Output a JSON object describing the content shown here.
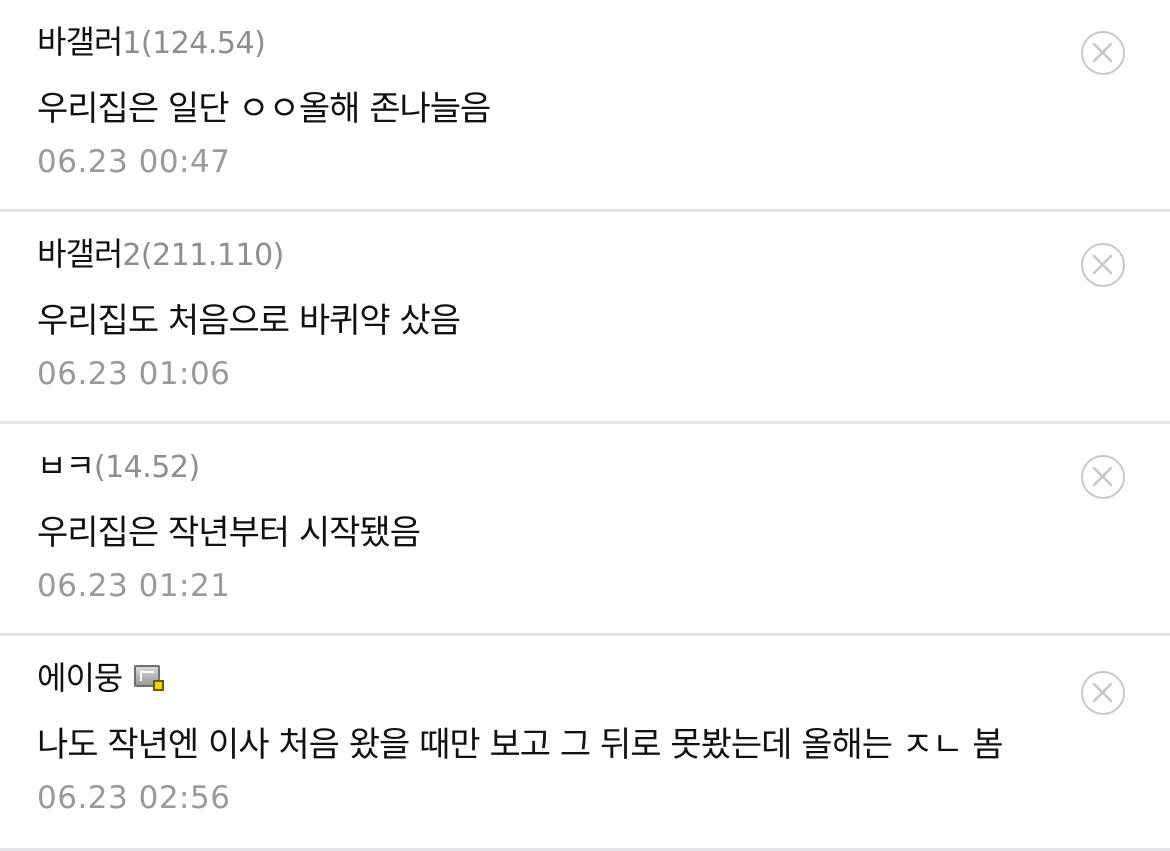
{
  "comments": [
    {
      "nick": "바갤러",
      "ip": "1(124.54)",
      "memo": "우리집은 일단 ㅇㅇ올해 존나늘음",
      "date": "06.23 00:47",
      "delete_icon": "circle-x-icon"
    },
    {
      "nick": "바갤러",
      "ip": "2(211.110)",
      "memo": "우리집도 처음으로 바퀴약 샀음",
      "date": "06.23 01:06",
      "delete_icon": "circle-x-icon"
    },
    {
      "nick": "ㅂㅋ",
      "ip": "(14.52)",
      "memo": "우리집은 작년부터 시작됐음",
      "date": "06.23 01:21",
      "delete_icon": "circle-x-icon"
    },
    {
      "nick": "에이뭉",
      "badge_icon": "fixed-nick-icon",
      "memo": "나도 작년엔 이사 처음 왔을 때만 보고 그 뒤로 못봤는데 올해는 ㅈㄴ 봄",
      "date": "06.23 02:56",
      "delete_icon": "circle-x-icon"
    }
  ]
}
